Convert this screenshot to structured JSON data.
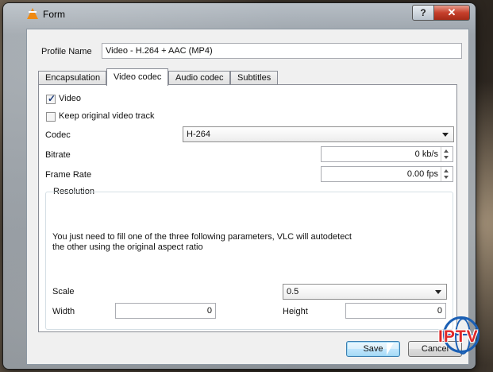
{
  "window": {
    "title": "Form"
  },
  "profile": {
    "label": "Profile Name",
    "value": "Video - H.264 + AAC (MP4)"
  },
  "tabs": [
    {
      "label": "Encapsulation"
    },
    {
      "label": "Video codec"
    },
    {
      "label": "Audio codec"
    },
    {
      "label": "Subtitles"
    }
  ],
  "video": {
    "video_checkbox": {
      "label": "Video",
      "checked": true
    },
    "keep_original": {
      "label": "Keep original video track",
      "checked": false
    },
    "codec": {
      "label": "Codec",
      "value": "H-264"
    },
    "bitrate": {
      "label": "Bitrate",
      "value": "0 kb/s"
    },
    "frame_rate": {
      "label": "Frame Rate",
      "value": "0.00 fps"
    }
  },
  "resolution": {
    "title": "Resolution",
    "info_line1": "You just need to fill one of the three following parameters, VLC will autodetect",
    "info_line2": "the other using the original aspect ratio",
    "scale": {
      "label": "Scale",
      "value": "0.5"
    },
    "width": {
      "label": "Width",
      "value": "0"
    },
    "height": {
      "label": "Height",
      "value": "0"
    }
  },
  "buttons": {
    "save": "Save",
    "cancel": "Cancel"
  },
  "watermark": {
    "text": "IPTV"
  },
  "icons": {
    "app": "vlc-cone-icon",
    "help": "help-icon",
    "close": "close-icon"
  },
  "colors": {
    "close_button": "#c6402c",
    "default_button": "#3c7fb1",
    "watermark": "#e02828"
  }
}
